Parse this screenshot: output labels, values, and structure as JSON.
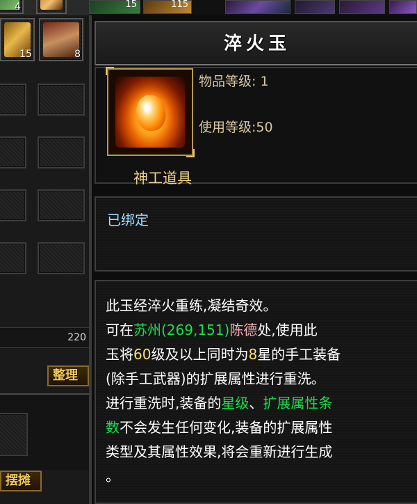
{
  "inventory": {
    "top_row_counts": [
      "4",
      "15",
      "115"
    ],
    "slots": [
      {
        "count": "15",
        "icon": "gold-ingot-icon"
      },
      {
        "count": "8",
        "icon": "paper-tag-icon"
      }
    ],
    "money_value": "220",
    "sort_button_label": "整理",
    "stall_button_label": "摆摊"
  },
  "tooltip": {
    "title": "淬火玉",
    "icon": "fire-jade-icon",
    "item_level_label": "物品等级:",
    "item_level_value": "1",
    "use_level_label": "使用等级:",
    "use_level_value": "50",
    "category": "神工道具",
    "bind_status": "已绑定",
    "description": {
      "line1": "此玉经淬火重练,凝结奇效。",
      "line2_a": "可在",
      "line2_city": "苏州",
      "line2_coords": "(269,151)",
      "line2_npc": "陈德",
      "line2_b": "处,使用此",
      "line3_a": "玉将",
      "line3_level": "60",
      "line3_b": "级及以上同时为",
      "line3_star": "8",
      "line3_c": "星的手工装备",
      "line4": "(除手工武器)的扩展属性进行重洗。",
      "line5_a": "进行重洗时,装备的",
      "line5_star": "星级",
      "line5_sep": "、",
      "line5_ext": "扩展属性条",
      "line6_ext": "数",
      "line6_b": "不会发生任何变化,装备的扩展属性",
      "line7": "类型及其属性效果,将会重新进行生成",
      "line8": "。"
    }
  },
  "colors": {
    "highlight_green": "#19e04a",
    "npc_pink": "#f2b0b0",
    "number_yellow": "#ffe070",
    "bind_blue": "#9fe0ff",
    "title_gold": "#f0d48a"
  }
}
